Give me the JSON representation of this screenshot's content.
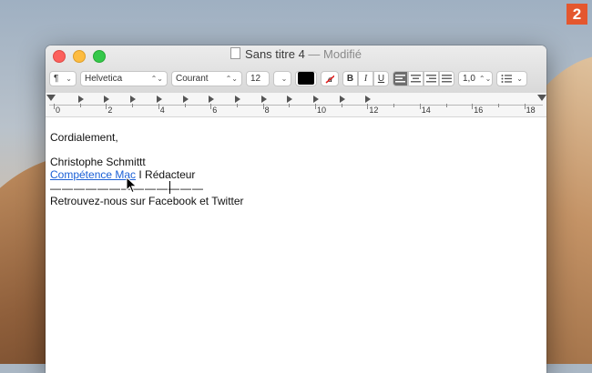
{
  "badge": "2",
  "window": {
    "title": "Sans titre 4",
    "modified": " — Modifié"
  },
  "toolbar": {
    "paragraph": "¶",
    "font": "Helvetica",
    "style": "Courant",
    "size": "12",
    "spacing": "1,0",
    "bold": "B",
    "italic": "I",
    "underline": "U",
    "text_color": "#000000"
  },
  "ruler": {
    "numbers": [
      "0",
      "2",
      "4",
      "6",
      "8",
      "10",
      "12",
      "14",
      "16",
      "18"
    ]
  },
  "document": {
    "line1": "Cordialement,",
    "line2": "Christophe Schmittt",
    "link": "Compétence Mac",
    "line3_rest": " I Rédacteur",
    "dashes": "—————————————",
    "line4": "Retrouvez-nous sur Facebook et Twitter"
  },
  "colors": {
    "link": "#1a5fd6",
    "badge": "#e4572e"
  }
}
